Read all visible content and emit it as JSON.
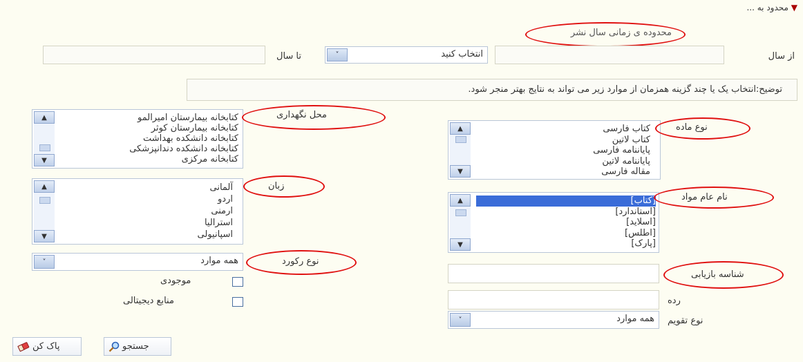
{
  "section_header": "محدود به ...",
  "time_range_title": "محدوده ی زمانی سال نشر",
  "from_year_label": "از سال",
  "to_year_label": "تا سال",
  "year_select_value": "انتخاب کنید",
  "note": "توضیح:انتخاب یک یا چند گزینه همزمان از موارد زیر می تواند به نتایج بهتر منجر شود.",
  "holding_location": {
    "label": "محل نگهداری",
    "items": [
      "کتابخانه بیمارستان امیرالمو",
      "کتابخانه بیمارستان کوثر",
      "کتابخانه دانشکده بهداشت",
      "کتابخانه دانشکده دندانپزشکی",
      "کتابخانه مرکزی"
    ]
  },
  "material_type": {
    "label": "نوع ماده",
    "items": [
      "کتاب فارسی",
      "کتاب لاتین",
      "پایاننامه فارسی",
      "پایاننامه لاتین",
      "مقاله فارسی"
    ]
  },
  "language": {
    "label": "زبان",
    "items": [
      "آلمانی",
      "اردو",
      "ارمنی",
      "استرالیا",
      "اسپانیولی"
    ]
  },
  "general_material": {
    "label": "نام عام مواد",
    "items": [
      "[کتاب]",
      "[استاندارد]",
      "[اسلاید]",
      "[اطلس]",
      "[پارک]"
    ]
  },
  "record_type": {
    "label": "نوع رکورد",
    "value": "همه موارد"
  },
  "available_label": "موجودی",
  "digital_resources_label": "منابع دیجیتالی",
  "access_id_label": "شناسه بازیابی",
  "rade_label": "رده",
  "calendar_type": {
    "label": "نوع تقویم",
    "value": "همه موارد"
  },
  "search_button": "جستجو",
  "clear_button": "پاک کن",
  "colors": {
    "annotation": "#e01010",
    "background": "#fdfdf2",
    "selected": "#3a6cd8"
  }
}
